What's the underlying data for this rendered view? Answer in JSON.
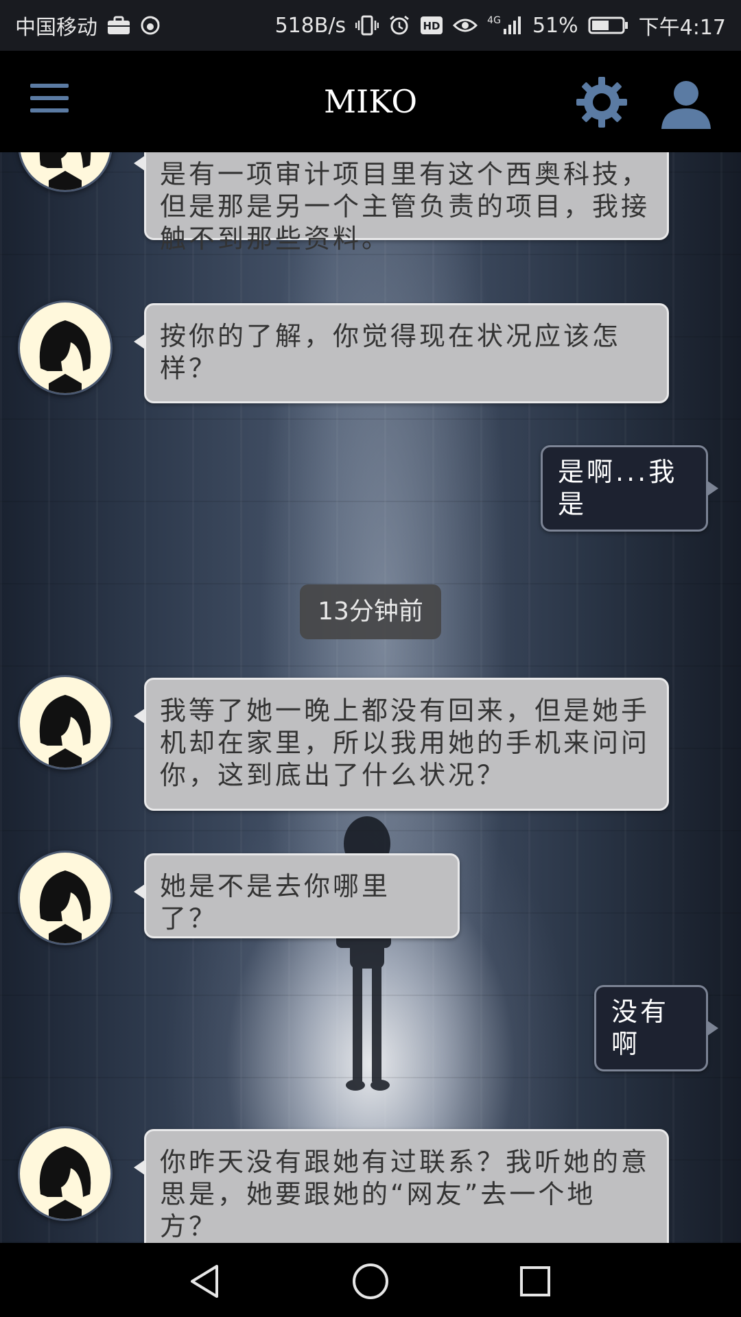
{
  "status_bar": {
    "carrier": "中国移动",
    "network_speed": "518B/s",
    "signal_type": "4G",
    "battery": "51%",
    "time": "下午4:17",
    "icons": [
      "briefcase-icon",
      "weibo-icon",
      "vibrate-icon",
      "alarm-icon",
      "hd-icon",
      "eye-icon",
      "signal-icon",
      "battery-icon"
    ]
  },
  "app_bar": {
    "title": "MIKO",
    "menu_icon": "menu-icon",
    "settings_icon": "gear-icon",
    "profile_icon": "user-icon"
  },
  "chat": {
    "messages": [
      {
        "from": "other",
        "text": "是有一项审计项目里有这个西奥科技，但是那是另一个主管负责的项目，我接触不到那些资料。"
      },
      {
        "from": "other",
        "text": "按你的了解，你觉得现在状况应该怎样？"
      },
      {
        "from": "me",
        "text": "是啊...我是"
      },
      {
        "type": "timestamp",
        "text": "13分钟前"
      },
      {
        "from": "other",
        "text": "我等了她一晚上都没有回来，但是她手机却在家里，所以我用她的手机来问问你，这到底出了什么状况？"
      },
      {
        "from": "other",
        "text": "她是不是去你哪里了？"
      },
      {
        "from": "me",
        "text": "没有啊"
      },
      {
        "from": "other",
        "text": "你昨天没有跟她有过联系？我听她的意思是，她要跟她的“网友”去一个地方？"
      }
    ]
  },
  "nav_bar": {
    "buttons": [
      "back-icon",
      "home-icon",
      "recents-icon"
    ]
  },
  "colors": {
    "app_bar_bg": "#000000",
    "accent_icon": "#5b7ba3",
    "incoming_bubble": "#bfbfc1",
    "outgoing_bubble": "#1d2230",
    "avatar_bg": "#fff8dc"
  }
}
